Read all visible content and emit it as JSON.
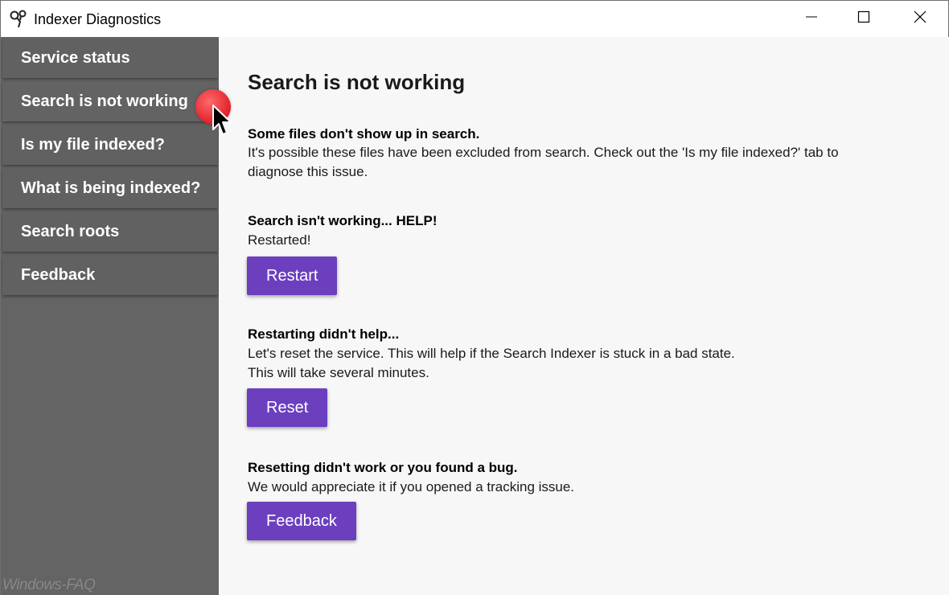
{
  "window": {
    "title": "Indexer Diagnostics"
  },
  "sidebar": {
    "items": [
      {
        "label": "Service status"
      },
      {
        "label": "Search is not working"
      },
      {
        "label": "Is my file indexed?"
      },
      {
        "label": "What is being indexed?"
      },
      {
        "label": "Search roots"
      },
      {
        "label": "Feedback"
      }
    ],
    "active": "Search is not working",
    "watermark": "Windows-FAQ"
  },
  "main": {
    "title": "Search is not working",
    "sections": [
      {
        "heading": "Some files don't show up in search.",
        "text_line1": "It's possible these files have been excluded from search. Check out the 'Is my file indexed?' tab to",
        "text_line2": "diagnose this issue."
      },
      {
        "heading": "Search isn't working... HELP!",
        "text_line1": "Restarted!",
        "button": "Restart"
      },
      {
        "heading": "Restarting didn't help...",
        "text_line1": "Let's reset the service. This will help if the Search Indexer is stuck in a bad state.",
        "text_line2": "This will take several minutes.",
        "button": "Reset"
      },
      {
        "heading": "Resetting didn't work or you found a bug.",
        "text_line1": "We would appreciate it if you opened a tracking issue.",
        "button": "Feedback"
      }
    ]
  },
  "colors": {
    "sidebar_bg": "#646464",
    "main_bg": "#f7f7f7",
    "accent_button": "#6b3fbe",
    "click_indicator": "#e0202a"
  },
  "icons": {
    "app": "app-logo-icon",
    "minimize": "minimize-icon",
    "maximize": "maximize-icon",
    "close": "close-icon",
    "cursor": "mouse-pointer-icon"
  }
}
